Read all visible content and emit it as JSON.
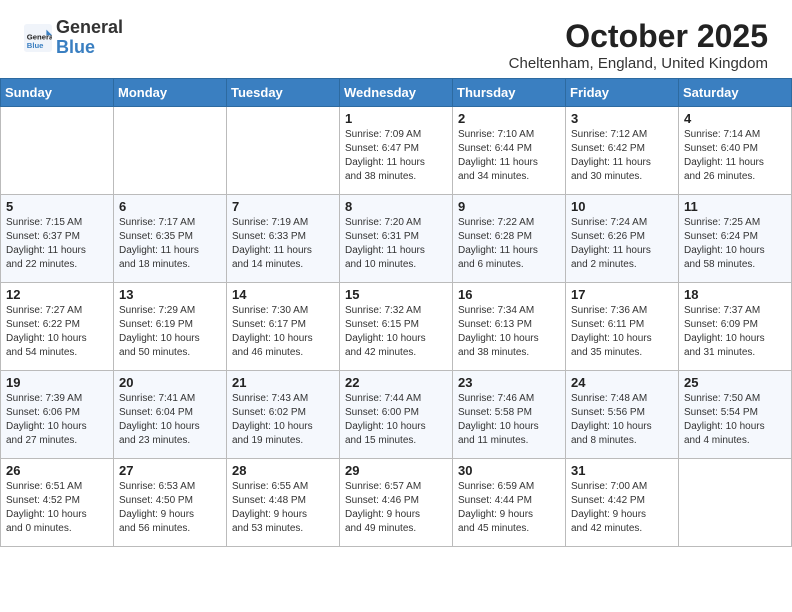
{
  "logo": {
    "general": "General",
    "blue": "Blue"
  },
  "title": "October 2025",
  "subtitle": "Cheltenham, England, United Kingdom",
  "days_of_week": [
    "Sunday",
    "Monday",
    "Tuesday",
    "Wednesday",
    "Thursday",
    "Friday",
    "Saturday"
  ],
  "weeks": [
    [
      {
        "day": "",
        "info": ""
      },
      {
        "day": "",
        "info": ""
      },
      {
        "day": "",
        "info": ""
      },
      {
        "day": "1",
        "info": "Sunrise: 7:09 AM\nSunset: 6:47 PM\nDaylight: 11 hours\nand 38 minutes."
      },
      {
        "day": "2",
        "info": "Sunrise: 7:10 AM\nSunset: 6:44 PM\nDaylight: 11 hours\nand 34 minutes."
      },
      {
        "day": "3",
        "info": "Sunrise: 7:12 AM\nSunset: 6:42 PM\nDaylight: 11 hours\nand 30 minutes."
      },
      {
        "day": "4",
        "info": "Sunrise: 7:14 AM\nSunset: 6:40 PM\nDaylight: 11 hours\nand 26 minutes."
      }
    ],
    [
      {
        "day": "5",
        "info": "Sunrise: 7:15 AM\nSunset: 6:37 PM\nDaylight: 11 hours\nand 22 minutes."
      },
      {
        "day": "6",
        "info": "Sunrise: 7:17 AM\nSunset: 6:35 PM\nDaylight: 11 hours\nand 18 minutes."
      },
      {
        "day": "7",
        "info": "Sunrise: 7:19 AM\nSunset: 6:33 PM\nDaylight: 11 hours\nand 14 minutes."
      },
      {
        "day": "8",
        "info": "Sunrise: 7:20 AM\nSunset: 6:31 PM\nDaylight: 11 hours\nand 10 minutes."
      },
      {
        "day": "9",
        "info": "Sunrise: 7:22 AM\nSunset: 6:28 PM\nDaylight: 11 hours\nand 6 minutes."
      },
      {
        "day": "10",
        "info": "Sunrise: 7:24 AM\nSunset: 6:26 PM\nDaylight: 11 hours\nand 2 minutes."
      },
      {
        "day": "11",
        "info": "Sunrise: 7:25 AM\nSunset: 6:24 PM\nDaylight: 10 hours\nand 58 minutes."
      }
    ],
    [
      {
        "day": "12",
        "info": "Sunrise: 7:27 AM\nSunset: 6:22 PM\nDaylight: 10 hours\nand 54 minutes."
      },
      {
        "day": "13",
        "info": "Sunrise: 7:29 AM\nSunset: 6:19 PM\nDaylight: 10 hours\nand 50 minutes."
      },
      {
        "day": "14",
        "info": "Sunrise: 7:30 AM\nSunset: 6:17 PM\nDaylight: 10 hours\nand 46 minutes."
      },
      {
        "day": "15",
        "info": "Sunrise: 7:32 AM\nSunset: 6:15 PM\nDaylight: 10 hours\nand 42 minutes."
      },
      {
        "day": "16",
        "info": "Sunrise: 7:34 AM\nSunset: 6:13 PM\nDaylight: 10 hours\nand 38 minutes."
      },
      {
        "day": "17",
        "info": "Sunrise: 7:36 AM\nSunset: 6:11 PM\nDaylight: 10 hours\nand 35 minutes."
      },
      {
        "day": "18",
        "info": "Sunrise: 7:37 AM\nSunset: 6:09 PM\nDaylight: 10 hours\nand 31 minutes."
      }
    ],
    [
      {
        "day": "19",
        "info": "Sunrise: 7:39 AM\nSunset: 6:06 PM\nDaylight: 10 hours\nand 27 minutes."
      },
      {
        "day": "20",
        "info": "Sunrise: 7:41 AM\nSunset: 6:04 PM\nDaylight: 10 hours\nand 23 minutes."
      },
      {
        "day": "21",
        "info": "Sunrise: 7:43 AM\nSunset: 6:02 PM\nDaylight: 10 hours\nand 19 minutes."
      },
      {
        "day": "22",
        "info": "Sunrise: 7:44 AM\nSunset: 6:00 PM\nDaylight: 10 hours\nand 15 minutes."
      },
      {
        "day": "23",
        "info": "Sunrise: 7:46 AM\nSunset: 5:58 PM\nDaylight: 10 hours\nand 11 minutes."
      },
      {
        "day": "24",
        "info": "Sunrise: 7:48 AM\nSunset: 5:56 PM\nDaylight: 10 hours\nand 8 minutes."
      },
      {
        "day": "25",
        "info": "Sunrise: 7:50 AM\nSunset: 5:54 PM\nDaylight: 10 hours\nand 4 minutes."
      }
    ],
    [
      {
        "day": "26",
        "info": "Sunrise: 6:51 AM\nSunset: 4:52 PM\nDaylight: 10 hours\nand 0 minutes."
      },
      {
        "day": "27",
        "info": "Sunrise: 6:53 AM\nSunset: 4:50 PM\nDaylight: 9 hours\nand 56 minutes."
      },
      {
        "day": "28",
        "info": "Sunrise: 6:55 AM\nSunset: 4:48 PM\nDaylight: 9 hours\nand 53 minutes."
      },
      {
        "day": "29",
        "info": "Sunrise: 6:57 AM\nSunset: 4:46 PM\nDaylight: 9 hours\nand 49 minutes."
      },
      {
        "day": "30",
        "info": "Sunrise: 6:59 AM\nSunset: 4:44 PM\nDaylight: 9 hours\nand 45 minutes."
      },
      {
        "day": "31",
        "info": "Sunrise: 7:00 AM\nSunset: 4:42 PM\nDaylight: 9 hours\nand 42 minutes."
      },
      {
        "day": "",
        "info": ""
      }
    ]
  ]
}
